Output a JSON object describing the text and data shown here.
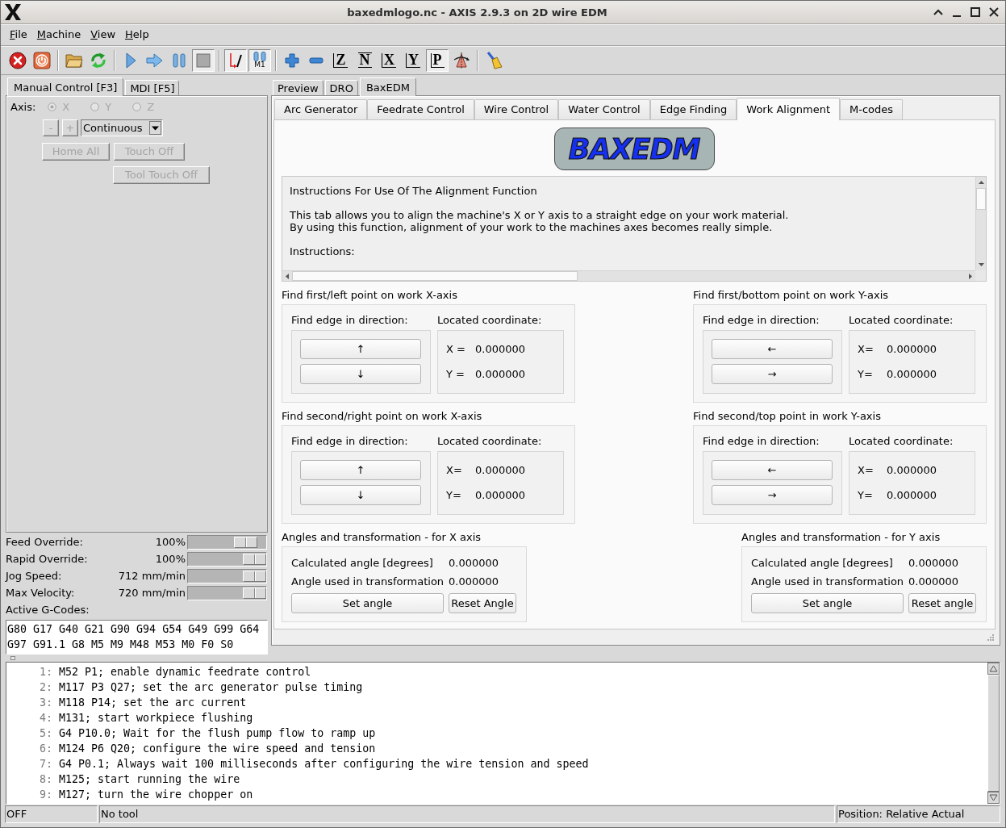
{
  "window": {
    "title": "baxedmlogo.nc - AXIS 2.9.3 on 2D wire EDM"
  },
  "menu": [
    "File",
    "Machine",
    "View",
    "Help"
  ],
  "toolbar": [
    [
      {
        "kind": "estop",
        "pressed": false
      },
      {
        "kind": "power",
        "pressed": false
      }
    ],
    [
      {
        "kind": "open",
        "pressed": false
      },
      {
        "kind": "reload",
        "pressed": false
      }
    ],
    [
      {
        "kind": "run",
        "pressed": false
      },
      {
        "kind": "step",
        "pressed": false
      },
      {
        "kind": "pause",
        "pressed": false
      },
      {
        "kind": "stop",
        "pressed": true
      }
    ],
    [
      {
        "kind": "block_delete",
        "pressed": true
      },
      {
        "kind": "optional_stop",
        "label": "M1",
        "pressed": true
      }
    ],
    [
      {
        "kind": "zoom_in",
        "pressed": false
      },
      {
        "kind": "zoom_out",
        "pressed": false
      },
      {
        "kind": "view",
        "label": "Z",
        "pressed": false
      },
      {
        "kind": "view_rotated",
        "label": "N",
        "pressed": false
      },
      {
        "kind": "view",
        "label": "X",
        "pressed": false
      },
      {
        "kind": "view",
        "label": "Y",
        "pressed": false
      },
      {
        "kind": "view_perspective",
        "label": "P",
        "pressed": true
      },
      {
        "kind": "rotate",
        "pressed": false
      }
    ],
    [
      {
        "kind": "clear",
        "pressed": false
      }
    ]
  ],
  "manual_tabs": [
    {
      "label": "Manual Control [F3]",
      "selected": true
    },
    {
      "label": "MDI [F5]",
      "selected": false
    }
  ],
  "manual": {
    "axis_label": "Axis:",
    "axes": [
      {
        "label": "X",
        "selected": true,
        "disabled": true
      },
      {
        "label": "Y",
        "selected": false,
        "disabled": true
      },
      {
        "label": "Z",
        "selected": false,
        "disabled": true
      }
    ],
    "jog_buttons": [
      {
        "label": "-",
        "disabled": true
      },
      {
        "label": "+",
        "disabled": true
      }
    ],
    "increment": {
      "value": "Continuous"
    },
    "buttons": [
      {
        "label": "Home All",
        "disabled": true
      },
      {
        "label": "Touch Off",
        "disabled": true
      },
      {
        "label": "Tool Touch Off",
        "disabled": true
      }
    ]
  },
  "overrides": [
    {
      "label": "Feed Override:",
      "reading": "100%",
      "level": 0.84
    },
    {
      "label": "Rapid Override:",
      "reading": "100%",
      "level": 1
    },
    {
      "label": "Jog Speed:",
      "reading": "712 mm/min",
      "level": 1
    },
    {
      "label": "Max Velocity:",
      "reading": "720 mm/min",
      "level": 1
    }
  ],
  "gcodes": {
    "label": "Active G-Codes:",
    "lines": [
      "G80 G17 G40 G21 G90 G94 G54 G49 G99 G64",
      "G97 G91.1 G8 M5 M9 M48 M53 M0 F0 S0"
    ]
  },
  "view_tabs": [
    {
      "label": "Preview",
      "selected": false
    },
    {
      "label": "DRO",
      "selected": false
    },
    {
      "label": "BaxEDM",
      "selected": true
    }
  ],
  "baxedm": {
    "tabs": [
      {
        "label": "Arc Generator",
        "selected": false
      },
      {
        "label": "Feedrate Control",
        "selected": false
      },
      {
        "label": "Wire Control",
        "selected": false
      },
      {
        "label": "Water Control",
        "selected": false
      },
      {
        "label": "Edge Finding",
        "selected": false
      },
      {
        "label": "Work Alignment",
        "selected": true
      },
      {
        "label": "M-codes",
        "selected": false
      }
    ],
    "logo": "BAXEDM",
    "instructions": [
      [
        "Instructions For Use Of The Alignment Function"
      ],
      [
        "This tab allows you to align the machine's X or Y axis to a straight edge on your work material.",
        "By using this function, alignment of your work to the machines axes becomes really simple."
      ],
      [
        "Instructions:"
      ]
    ],
    "point_groups": [
      {
        "title": "Find first/left point on work X-axis",
        "direction_label": "Find edge in direction:",
        "coordinate_label": "Located coordinate:",
        "buttons": [
          "↑",
          "↓"
        ],
        "coordinates": [
          {
            "label": "X =",
            "value": "0.000000"
          },
          {
            "label": "Y =",
            "value": "0.000000"
          }
        ]
      },
      {
        "title": "Find first/bottom point on work Y-axis",
        "direction_label": "Find edge in direction:",
        "coordinate_label": "Located coordinate:",
        "buttons": [
          "←",
          "→"
        ],
        "coordinates": [
          {
            "label": "X=",
            "value": "0.000000"
          },
          {
            "label": "Y=",
            "value": "0.000000"
          }
        ]
      },
      {
        "title": "Find second/right point on work X-axis",
        "direction_label": "Find edge in direction:",
        "coordinate_label": "Located coordinate:",
        "buttons": [
          "↑",
          "↓"
        ],
        "coordinates": [
          {
            "label": "X=",
            "value": "0.000000"
          },
          {
            "label": "Y=",
            "value": "0.000000"
          }
        ]
      },
      {
        "title": "Find second/top point in work Y-axis",
        "direction_label": "Find edge in direction:",
        "coordinate_label": "Located coordinate:",
        "buttons": [
          "←",
          "→"
        ],
        "coordinates": [
          {
            "label": "X=",
            "value": "0.000000"
          },
          {
            "label": "Y=",
            "value": "0.000000"
          }
        ]
      }
    ],
    "angle_groups": [
      {
        "title": "Angles and transformation - for X axis",
        "rows": [
          {
            "label": "Calculated angle [degrees]",
            "value": "0.000000"
          },
          {
            "label": "Angle used in transformation",
            "value": "0.000000"
          }
        ],
        "buttons": [
          "Set angle",
          "Reset Angle"
        ]
      },
      {
        "title": "Angles and transformation - for Y axis",
        "rows": [
          {
            "label": "Calculated angle [degrees]",
            "value": "0.000000"
          },
          {
            "label": "Angle used in transformation",
            "value": "0.000000"
          }
        ],
        "buttons": [
          "Set angle",
          "Reset angle"
        ]
      }
    ]
  },
  "program": [
    {
      "number": "1:",
      "code": "M52 P1; enable dynamic feedrate control"
    },
    {
      "number": "2:",
      "code": "M117 P3 Q27; set the arc generator pulse timing"
    },
    {
      "number": "3:",
      "code": "M118 P14; set the arc current"
    },
    {
      "number": "4:",
      "code": "M131; start workpiece flushing"
    },
    {
      "number": "5:",
      "code": "G4 P10.0; Wait for the flush pump flow to ramp up"
    },
    {
      "number": "6:",
      "code": "M124 P6 Q20; configure the wire speed and tension"
    },
    {
      "number": "7:",
      "code": "G4 P0.1; Always wait 100 milliseconds after configuring the wire tension and speed"
    },
    {
      "number": "8:",
      "code": "M125; start running the wire"
    },
    {
      "number": "9:",
      "code": "M127; turn the wire chopper on"
    }
  ],
  "status_bar": [
    "OFF",
    "No tool",
    "Position: Relative Actual"
  ]
}
